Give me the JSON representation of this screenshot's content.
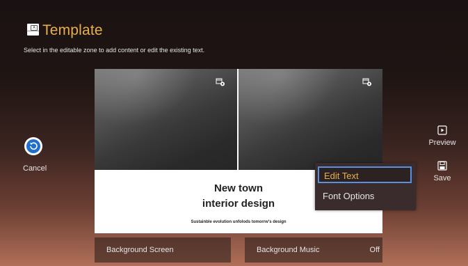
{
  "header": {
    "icon": "template-icon",
    "icon_letter": "A",
    "title": "Template",
    "subtitle": "Select in the editable zone to add content or edit the existing text."
  },
  "template": {
    "headline_line1": "New town",
    "headline_line2": "interior design",
    "tagline": "Sustainble evolution unfolods tomorrw's design",
    "media_icon": "media-settings-icon"
  },
  "actions": {
    "cancel_label": "Cancel",
    "preview_label": "Preview",
    "save_label": "Save"
  },
  "context_menu": {
    "items": [
      {
        "label": "Edit Text",
        "selected": true
      },
      {
        "label": "Font Options",
        "selected": false
      }
    ]
  },
  "bottom": {
    "background_screen_label": "Background Screen",
    "background_music_label": "Background Music",
    "background_music_value": "Off"
  },
  "colors": {
    "accent": "#e8b04a",
    "focus_border": "#5b8fe0",
    "cancel_blue": "#1e6fd0"
  }
}
